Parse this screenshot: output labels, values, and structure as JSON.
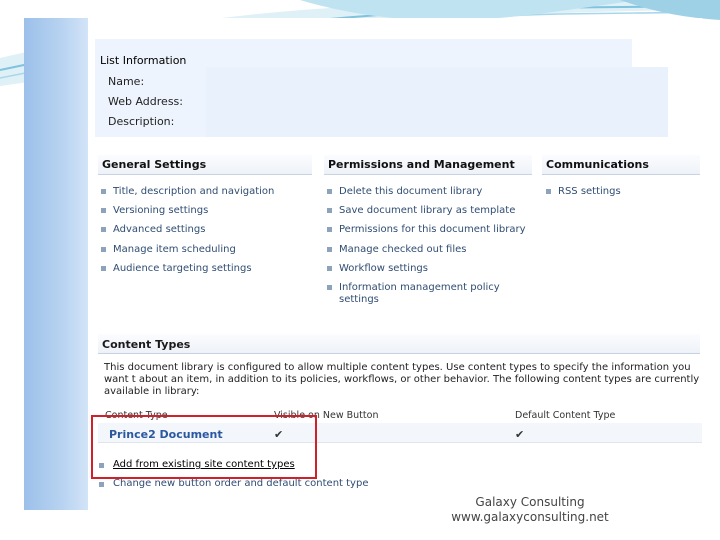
{
  "list_information": {
    "heading": "List Information",
    "name_label": "Name:",
    "web_address_label": "Web Address:",
    "description_label": "Description:"
  },
  "general_settings": {
    "heading": "General Settings",
    "items": [
      "Title, description and navigation",
      "Versioning settings",
      "Advanced settings",
      "Manage item scheduling",
      "Audience targeting settings"
    ]
  },
  "permissions_management": {
    "heading": "Permissions and Management",
    "items": [
      "Delete this document library",
      "Save document library as template",
      "Permissions for this document library",
      "Manage checked out files",
      "Workflow settings",
      "Information management policy settings"
    ]
  },
  "communications": {
    "heading": "Communications",
    "items": [
      "RSS settings"
    ]
  },
  "content_types": {
    "heading": "Content Types",
    "description": "This document library is configured to allow multiple content types. Use content types to specify the information you want t about an item, in addition to its policies, workflows, or other behavior. The following content types are currently available in library:",
    "columns": [
      "Content Type",
      "Visible on New Button",
      "Default Content Type"
    ],
    "rows": [
      {
        "name": "Prince2 Document",
        "visible": "✔",
        "default": "✔"
      }
    ],
    "links": [
      "Add from existing site content types",
      "Change new button order and default content type"
    ]
  },
  "footer": {
    "company": "Galaxy Consulting",
    "website": "www.galaxyconsulting.net"
  }
}
